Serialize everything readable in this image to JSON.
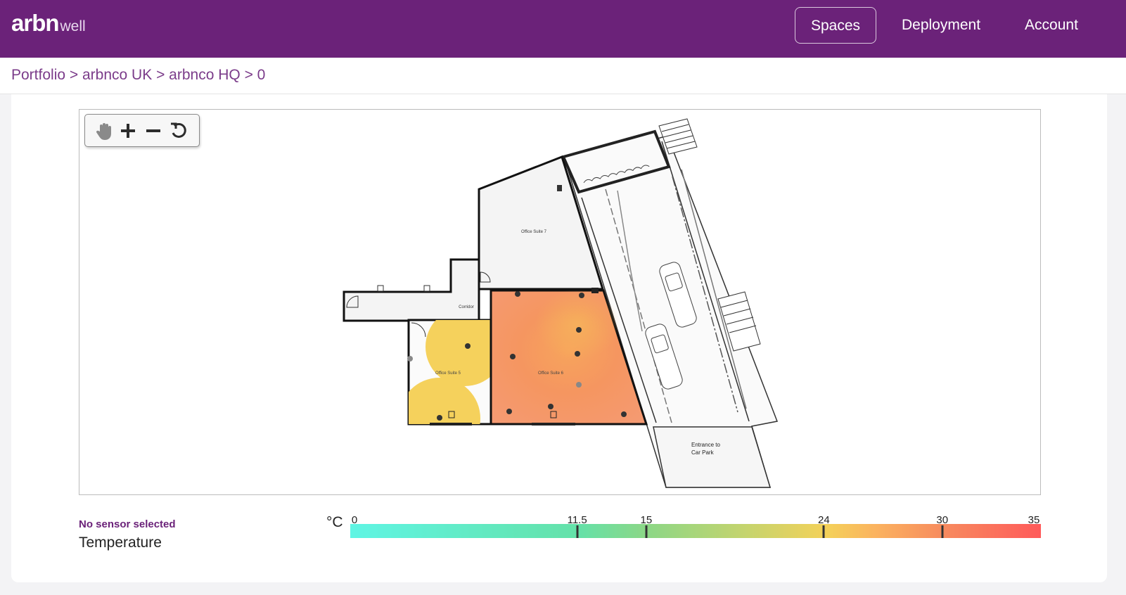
{
  "header": {
    "logo_main": "arbn",
    "logo_sub": "well",
    "nav": [
      {
        "label": "Spaces",
        "active": true
      },
      {
        "label": "Deployment",
        "active": false
      },
      {
        "label": "Account",
        "active": false
      }
    ]
  },
  "breadcrumb": [
    "Portfolio",
    "arbnco UK",
    "arbnco HQ",
    "0"
  ],
  "breadcrumb_separator": ">",
  "toolbar": {
    "icons": [
      "pan-hand-icon",
      "zoom-in-icon",
      "zoom-out-icon",
      "reset-icon"
    ]
  },
  "floorplan": {
    "rooms": [
      "Office Suite 7",
      "Corridor",
      "Office Suite 5",
      "Office Suite 6"
    ],
    "entrance_line1": "Entrance to",
    "entrance_line2": "Car Park"
  },
  "legend": {
    "status": "No sensor selected",
    "metric": "Temperature",
    "unit": "°C",
    "ticks": [
      "0",
      "11.5",
      "15",
      "24",
      "30",
      "35"
    ],
    "tick_values": [
      0,
      11.5,
      15,
      24,
      30,
      35
    ],
    "min": 0,
    "max": 35
  },
  "colors": {
    "brand": "#6b2279",
    "heat_orange": "#f5925d",
    "heat_yellow": "#f5d15c"
  }
}
